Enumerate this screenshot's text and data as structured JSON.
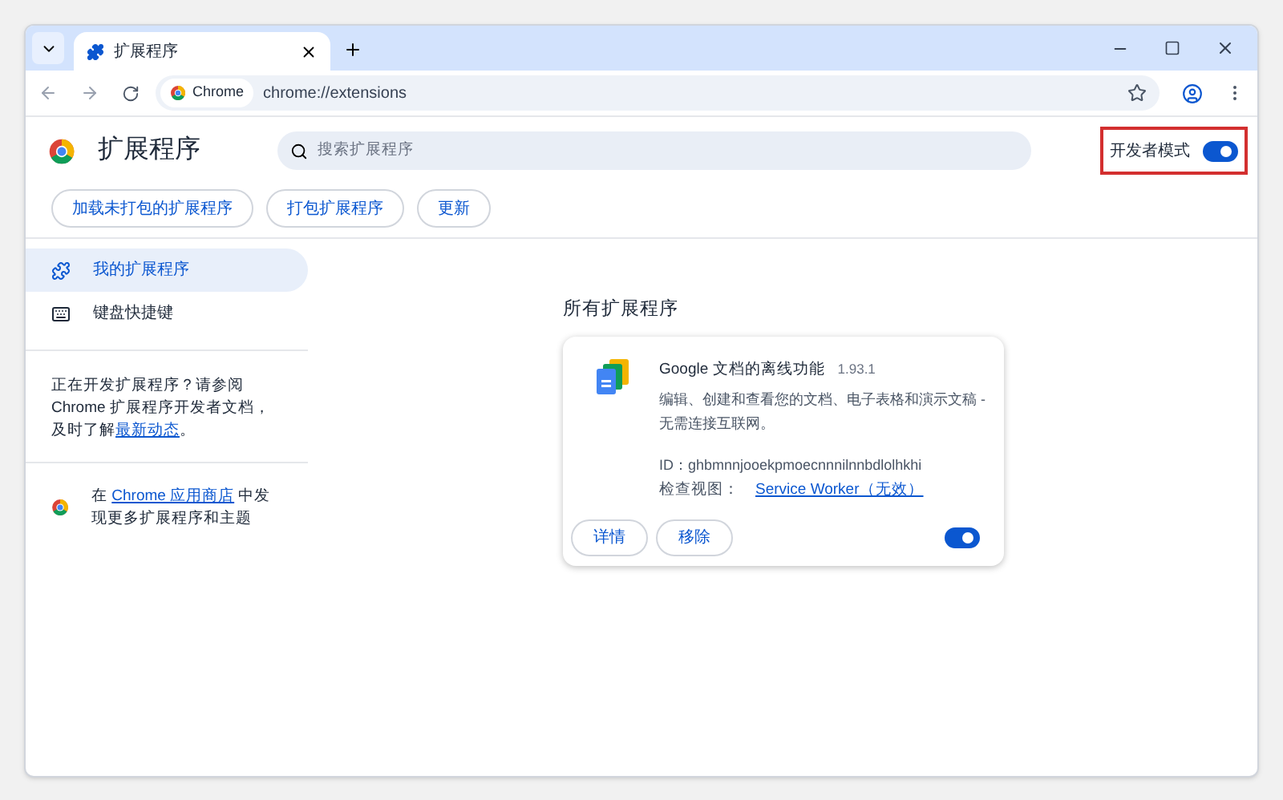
{
  "tab": {
    "title": "扩展程序",
    "selected": true
  },
  "address_bar": {
    "chip": "Chrome",
    "url": "chrome://extensions"
  },
  "header": {
    "title": "扩展程序",
    "search_placeholder": "搜索扩展程序",
    "developer_mode": {
      "label": "开发者模式",
      "on": true,
      "highlighted": true
    }
  },
  "toolbar_buttons": [
    "加载未打包的扩展程序",
    "打包扩展程序",
    "更新"
  ],
  "sidebar": {
    "items": [
      {
        "kind": "extensions",
        "label": "我的扩展程序",
        "selected": true
      },
      {
        "kind": "keyboard",
        "label": "键盘快捷键",
        "selected": false
      }
    ],
    "dev_note": {
      "before": "正在开发扩展程序？请参阅 Chrome 扩展程序开发者文档，及时了解",
      "link": "最新动态",
      "after": "。"
    },
    "store_note": {
      "before": "在 ",
      "link": "Chrome 应用商店",
      "after": " 中发现更多扩展程序和主题"
    }
  },
  "section_title": "所有扩展程序",
  "extensions": [
    {
      "name": "Google 文档的离线功能",
      "version": "1.93.1",
      "description": "编辑、创建和查看您的文档、电子表格和演示文稿 - 无需连接互联网。",
      "id": "ID：ghbmnnjooekpmoecnnnilnnbdlolhkhi",
      "views_label": "检查视图：",
      "views_link": "Service Worker（无效）",
      "buttons": [
        "详情",
        "移除"
      ],
      "enabled": true
    }
  ]
}
